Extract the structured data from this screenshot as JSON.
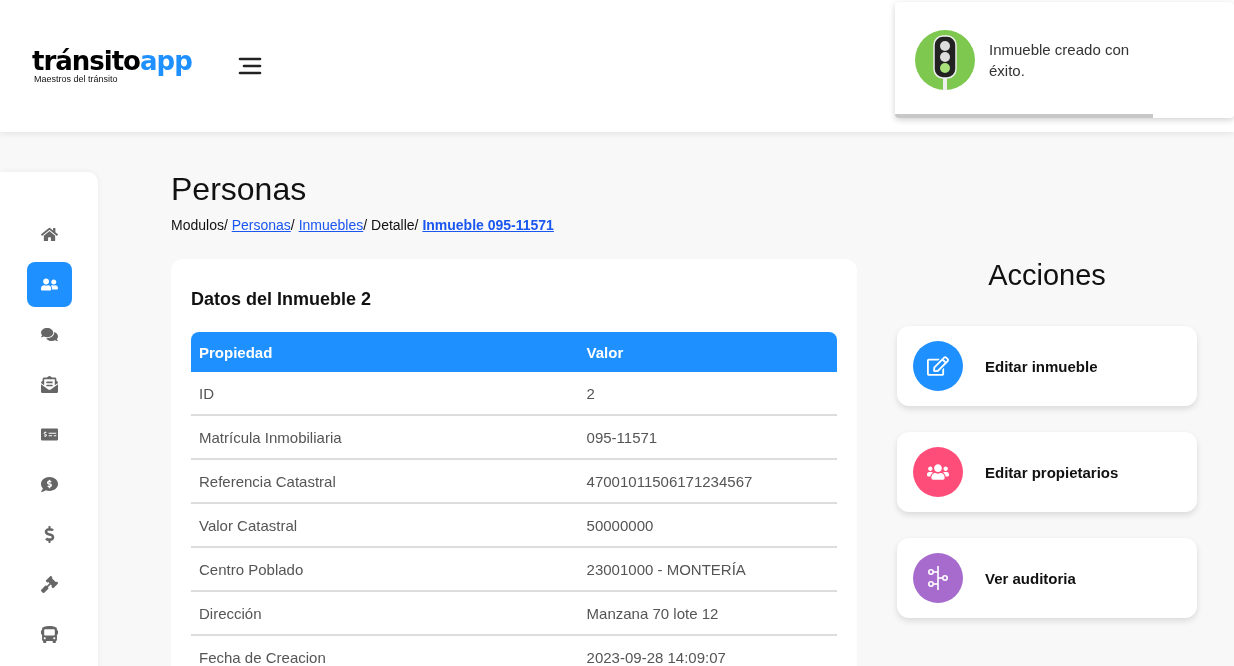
{
  "header": {
    "logo": {
      "main": "tránsito",
      "accent": "app",
      "tagline": "Maestros del tránsito"
    }
  },
  "toast": {
    "message": "Inmueble creado con éxito.",
    "level": 0.76
  },
  "sidebar": {
    "items": [
      {
        "kind": "home",
        "selected": false
      },
      {
        "kind": "people",
        "selected": true
      },
      {
        "kind": "questions",
        "selected": false
      },
      {
        "kind": "mail",
        "selected": false
      },
      {
        "kind": "billing",
        "selected": false
      },
      {
        "kind": "money-chat",
        "selected": false
      },
      {
        "kind": "dollar",
        "selected": false
      },
      {
        "kind": "gavel",
        "selected": false
      },
      {
        "kind": "bus",
        "selected": false
      }
    ]
  },
  "page": {
    "title": "Personas",
    "breadcrumb": [
      {
        "label": "Modulos/",
        "kind": "text"
      },
      {
        "label": "Personas",
        "kind": "link",
        "separator": "/"
      },
      {
        "label": "Inmuebles",
        "kind": "link",
        "separator": "/"
      },
      {
        "label": "Detalle/",
        "kind": "text"
      },
      {
        "label": "Inmueble 095-11571",
        "kind": "current"
      }
    ]
  },
  "details": {
    "title": "Datos del Inmueble 2",
    "columns": [
      "Propiedad",
      "Valor"
    ],
    "rows": [
      [
        "ID",
        "2"
      ],
      [
        "Matrícula Inmobiliaria",
        "095-11571"
      ],
      [
        "Referencia Catastral",
        "47001011506171234567"
      ],
      [
        "Valor Catastral",
        "50000000"
      ],
      [
        "Centro Poblado",
        "23001000 - MONTERÍA"
      ],
      [
        "Dirección",
        "Manzana 70 lote 12"
      ],
      [
        "Fecha de Creacion",
        "2023-09-28 14:09:07"
      ]
    ]
  },
  "actions": {
    "title": "Acciones",
    "items": [
      {
        "label": "Editar inmueble",
        "kind": "edit",
        "color": "#1e90ff"
      },
      {
        "label": "Editar propietarios",
        "kind": "owners",
        "color": "#ff4d79"
      },
      {
        "label": "Ver auditoria",
        "kind": "audit",
        "color": "#a66bcc"
      }
    ]
  }
}
